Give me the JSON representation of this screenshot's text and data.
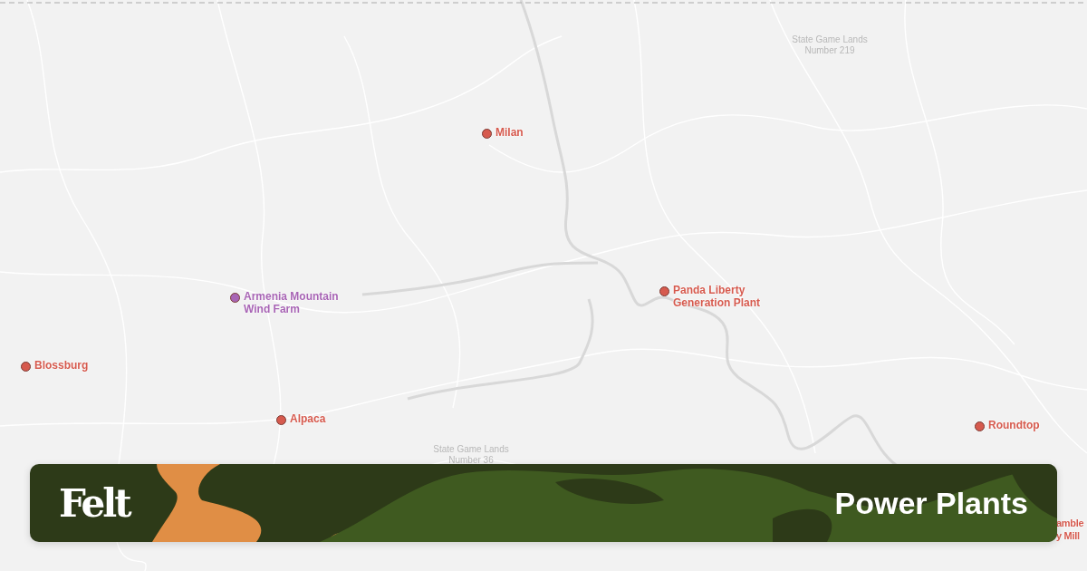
{
  "map": {
    "areas": [
      {
        "lines": [
          "State Game Lands",
          "Number 219"
        ]
      },
      {
        "lines": [
          "State Game Lands",
          "Number 36"
        ]
      }
    ],
    "plants": [
      {
        "lines": [
          "Milan"
        ],
        "color": "#d65a4e"
      },
      {
        "lines": [
          "Armenia Mountain",
          "Wind Farm"
        ],
        "color": "#a865b5"
      },
      {
        "lines": [
          "Blossburg"
        ],
        "color": "#d65a4e"
      },
      {
        "lines": [
          "Alpaca"
        ],
        "color": "#d65a4e"
      },
      {
        "lines": [
          "Panda Liberty",
          "Generation Plant"
        ],
        "color": "#d65a4e"
      },
      {
        "lines": [
          "Roundtop"
        ],
        "color": "#d65a4e"
      }
    ],
    "cut_label": {
      "lines": [
        "amble",
        "y Mill"
      ],
      "color": "#d65a4e"
    }
  },
  "banner": {
    "logo": "Felt",
    "title": "Power Plants"
  }
}
